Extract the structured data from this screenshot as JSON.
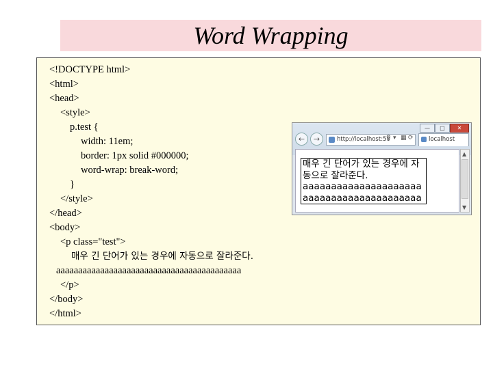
{
  "slide": {
    "title": "Word Wrapping"
  },
  "code": {
    "lines": [
      "<!DOCTYPE html>",
      "<html>",
      "<head>",
      "<style>",
      "p.test {",
      "width: 11em;",
      "border: 1px solid #000000;",
      "word-wrap: break-word;",
      "}",
      "</style>",
      "</head>",
      "<body>",
      "<p class=\"test\">",
      "매우 긴 단어가 있는 경우에 자동으로 잘라준다.",
      "aaaaaaaaaaaaaaaaaaaaaaaaaaaaaaaaaaaaaaaaaa",
      "</p>",
      "</body>",
      "</html>"
    ]
  },
  "browser": {
    "address": "http://localhost:50",
    "tab_label": "localhost",
    "rendered_text": "매우 긴 단어가 있는 경우에 자동으로 잘라준다. aaaaaaaaaaaaaaaaaaaaaaaaaaaaaaaaaaaaaaaaaa",
    "icons": [
      "back-arrow-icon",
      "forward-arrow-icon",
      "search-icon",
      "refresh-icon",
      "minimize-icon",
      "maximize-icon",
      "close-icon"
    ]
  }
}
